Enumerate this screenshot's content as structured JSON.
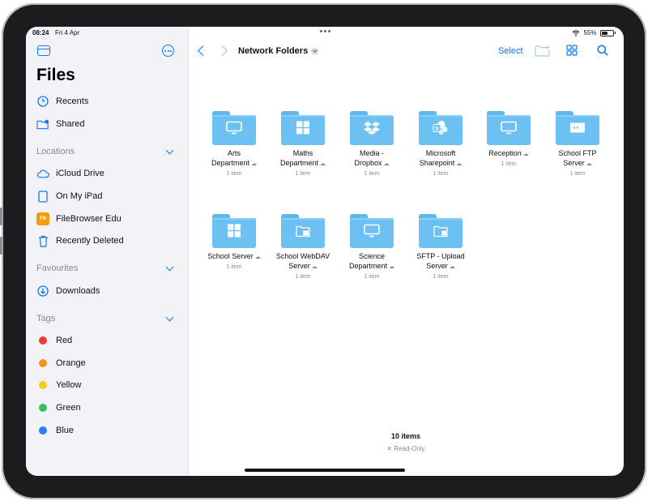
{
  "status": {
    "time": "08:24",
    "date": "Fri 4 Apr",
    "battery": "55%",
    "battery_level": 0.55
  },
  "sidebar": {
    "title": "Files",
    "top_items": [
      {
        "label": "Recents",
        "icon": "clock-icon"
      },
      {
        "label": "Shared",
        "icon": "shared-folder-icon"
      }
    ],
    "locations": {
      "header": "Locations",
      "items": [
        {
          "label": "iCloud Drive",
          "icon": "cloud-icon"
        },
        {
          "label": "On My iPad",
          "icon": "ipad-icon"
        },
        {
          "label": "FileBrowser Edu",
          "icon": "filebrowser-icon",
          "badge": "FB"
        },
        {
          "label": "Recently Deleted",
          "icon": "trash-icon"
        }
      ]
    },
    "favourites": {
      "header": "Favourites",
      "items": [
        {
          "label": "Downloads",
          "icon": "download-icon"
        }
      ]
    },
    "tags": {
      "header": "Tags",
      "items": [
        {
          "label": "Red",
          "color": "#ee3b34"
        },
        {
          "label": "Orange",
          "color": "#f5921e"
        },
        {
          "label": "Yellow",
          "color": "#f6cb1b"
        },
        {
          "label": "Green",
          "color": "#35c05a"
        },
        {
          "label": "Blue",
          "color": "#2a7ff5"
        }
      ]
    }
  },
  "toolbar": {
    "location_title": "Network Folders",
    "select_label": "Select"
  },
  "folders": [
    {
      "line1": "Arts",
      "line2": "Department",
      "sub": "1 item",
      "glyph": "monitor-icon"
    },
    {
      "line1": "Maths",
      "line2": "Department",
      "sub": "1 item",
      "glyph": "windows-icon"
    },
    {
      "line1": "Media -",
      "line2": "Dropbox",
      "sub": "1 item",
      "glyph": "dropbox-icon"
    },
    {
      "line1": "Microsoft",
      "line2": "Sharepoint",
      "sub": "1 item",
      "glyph": "sharepoint-icon"
    },
    {
      "line1": "Reception",
      "line2": "",
      "sub": "1 item",
      "glyph": "monitor-icon"
    },
    {
      "line1": "School FTP",
      "line2": "Server",
      "sub": "1 item",
      "glyph": "ftp-server-icon"
    },
    {
      "line1": "School Server",
      "line2": "",
      "sub": "1 item",
      "glyph": "windows-icon"
    },
    {
      "line1": "School WebDAV",
      "line2": "Server",
      "sub": "1 item",
      "glyph": "webdav-icon"
    },
    {
      "line1": "Science",
      "line2": "Department",
      "sub": "1 item",
      "glyph": "monitor-icon"
    },
    {
      "line1": "SFTP - Upload",
      "line2": "Server",
      "sub": "1 item",
      "glyph": "sftp-icon"
    }
  ],
  "footer": {
    "count": "10 items",
    "readonly": "Read-Only"
  },
  "colors": {
    "accent": "#0a7aff",
    "folder": "#6cc1f2",
    "sidebar_bg": "#f2f2f7"
  }
}
